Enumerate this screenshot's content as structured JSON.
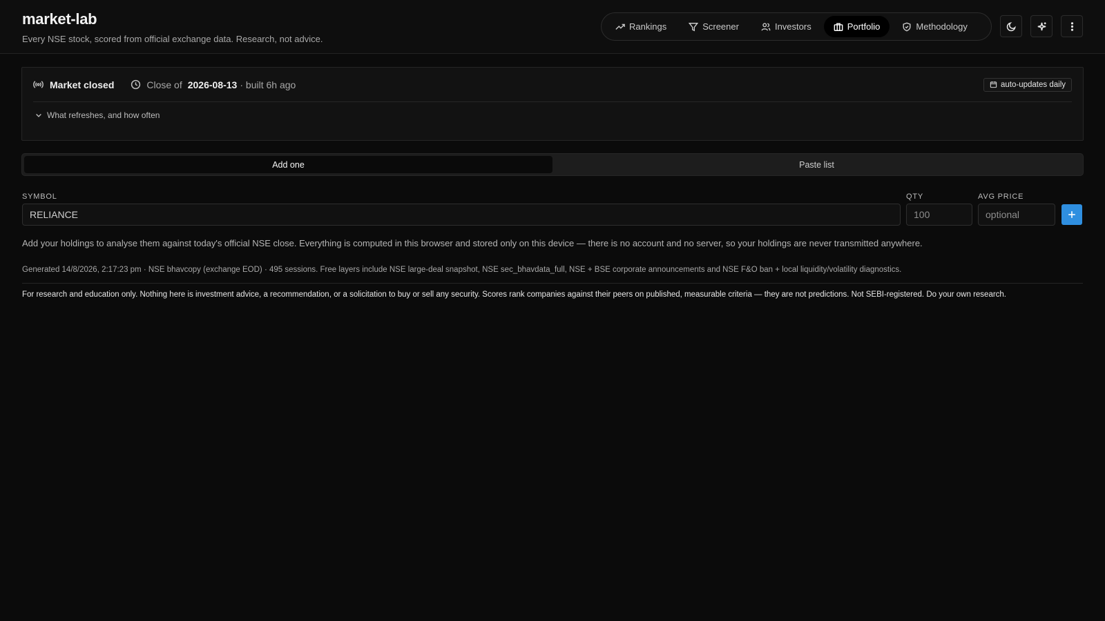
{
  "brand": {
    "title": "market-lab",
    "subtitle": "Every NSE stock, scored from official exchange data. Research, not advice."
  },
  "nav": {
    "items": [
      {
        "label": "Rankings",
        "icon": "trending-up-icon"
      },
      {
        "label": "Screener",
        "icon": "filter-icon"
      },
      {
        "label": "Investors",
        "icon": "users-icon"
      },
      {
        "label": "Portfolio",
        "icon": "briefcase-icon",
        "active": true
      },
      {
        "label": "Methodology",
        "icon": "shield-icon"
      }
    ]
  },
  "header_actions": {
    "theme": "moon-icon",
    "effects": "sparkles-icon",
    "more": "more-vertical-icon"
  },
  "status": {
    "market_label": "Market closed",
    "close_prefix": "Close of",
    "close_date": "2026-08-13",
    "built": "· built 6h ago",
    "auto_badge": "auto-updates daily",
    "refresh_toggle": "What refreshes, and how often"
  },
  "segment": {
    "add_one": "Add one",
    "paste_list": "Paste list"
  },
  "form": {
    "symbol_label": "SYMBOL",
    "symbol_value": "RELIANCE",
    "qty_label": "QTY",
    "qty_placeholder": "100",
    "avg_label": "AVG PRICE",
    "avg_placeholder": "optional"
  },
  "info_text": "Add your holdings to analyse them against today's official NSE close. Everything is computed in this browser and stored only on this device — there is no account and no server, so your holdings are never transmitted anywhere.",
  "generated_text": "Generated 14/8/2026, 2:17:23 pm · NSE bhavcopy (exchange EOD) · 495 sessions. Free layers include NSE large-deal snapshot, NSE sec_bhavdata_full, NSE + BSE corporate announcements and NSE F&O ban + local liquidity/volatility diagnostics.",
  "disclaimer": "For research and education only. Nothing here is investment advice, a recommendation, or a solicitation to buy or sell any security. Scores rank companies against their peers on published, measurable criteria — they are not predictions. Not SEBI-registered. Do your own research.",
  "colors": {
    "accent": "#2f8fe0",
    "background": "#0b0b0b"
  }
}
